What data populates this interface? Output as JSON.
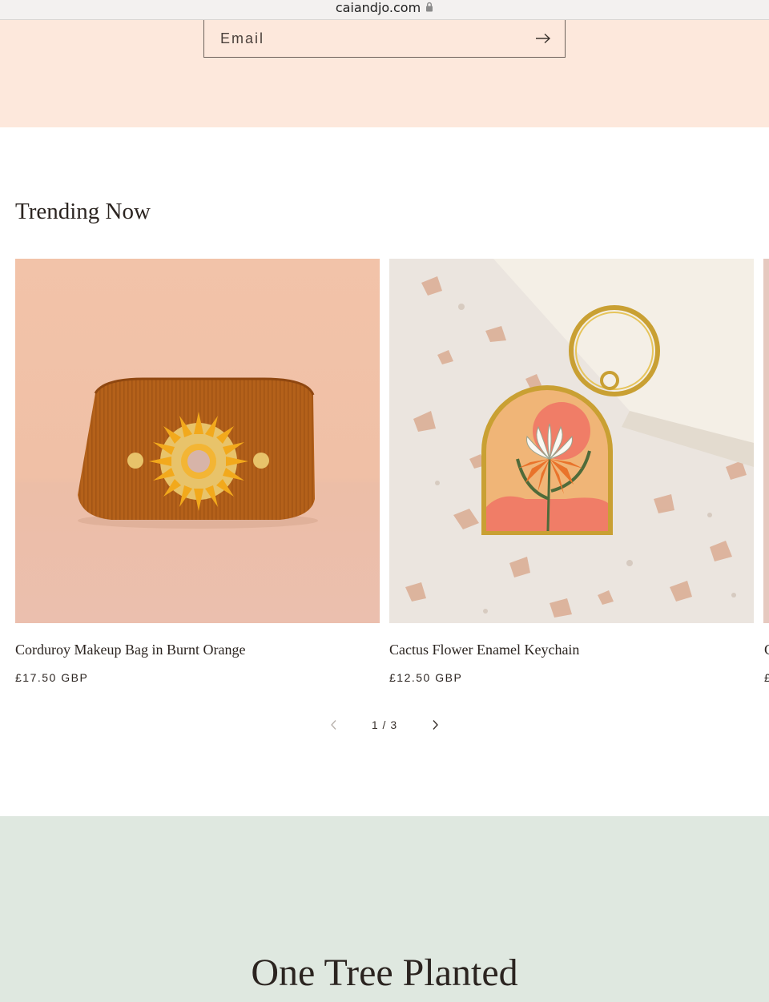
{
  "browser": {
    "domain": "caiandjo.com",
    "lock_icon": "lock-icon"
  },
  "newsletter": {
    "email_placeholder": "Email",
    "submit_icon": "arrow-right-icon",
    "background": "#fde8dc"
  },
  "trending": {
    "title": "Trending Now",
    "products": [
      {
        "name": "Corduroy Makeup Bag in Burnt Orange",
        "price": "£17.50 GBP"
      },
      {
        "name": "Cactus Flower Enamel Keychain",
        "price": "£12.50 GBP"
      },
      {
        "name": "C",
        "price": "£"
      }
    ],
    "pagination": {
      "current": "1 / 3",
      "prev_icon": "chevron-left-icon",
      "next_icon": "chevron-right-icon"
    }
  },
  "one_tree": {
    "title": "One Tree Planted",
    "background": "#dfe8e0"
  }
}
